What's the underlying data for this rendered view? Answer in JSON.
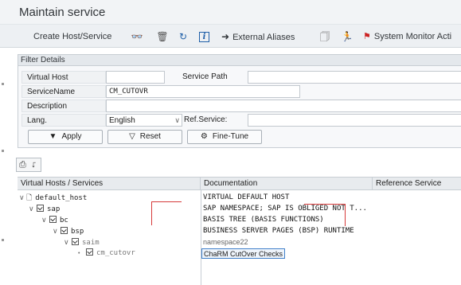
{
  "window": {
    "title": "Maintain service"
  },
  "toolbar": {
    "create_label": "Create Host/Service",
    "external_aliases_label": "External Aliases",
    "system_monitor_label": "System Monitor Acti",
    "icons": [
      "glasses-icon",
      "trash-icon",
      "refresh-icon",
      "info-icon",
      "arrow-right-icon",
      "document-icon",
      "runner-icon",
      "flag-icon"
    ]
  },
  "filter": {
    "header": "Filter Details",
    "virtual_host_label": "Virtual Host",
    "virtual_host_value": "",
    "service_path_label": "Service Path",
    "service_path_value": "",
    "service_name_label": "ServiceName",
    "service_name_value": "CM_CUTOVR",
    "description_label": "Description",
    "description_value": "",
    "lang_label": "Lang.",
    "lang_value": "English",
    "ref_service_label": "Ref.Service:",
    "ref_service_value": "",
    "apply_label": "Apply",
    "reset_label": "Reset",
    "finetune_label": "Fine-Tune"
  },
  "tree": {
    "col_host": "Virtual Hosts / Services",
    "col_doc": "Documentation",
    "col_ref": "Reference Service",
    "rows": [
      {
        "name": "default_host",
        "doc": "VIRTUAL DEFAULT HOST"
      },
      {
        "name": "sap",
        "doc": "SAP NAMESPACE; SAP IS OBLIGED NOT T..."
      },
      {
        "name": "bc",
        "doc": "BASIS TREE (BASIS FUNCTIONS)"
      },
      {
        "name": "bsp",
        "doc": "BUSINESS SERVER PAGES (BSP) RUNTIME"
      },
      {
        "name": "saim",
        "doc": "namespace22"
      },
      {
        "name": "cm_cutovr",
        "doc": "ChaRM CutOver Checks"
      }
    ]
  },
  "colors": {
    "accent": "#3f7fc9",
    "marker": "#d63a3a",
    "toolbar_bg": "#edf0f3"
  }
}
